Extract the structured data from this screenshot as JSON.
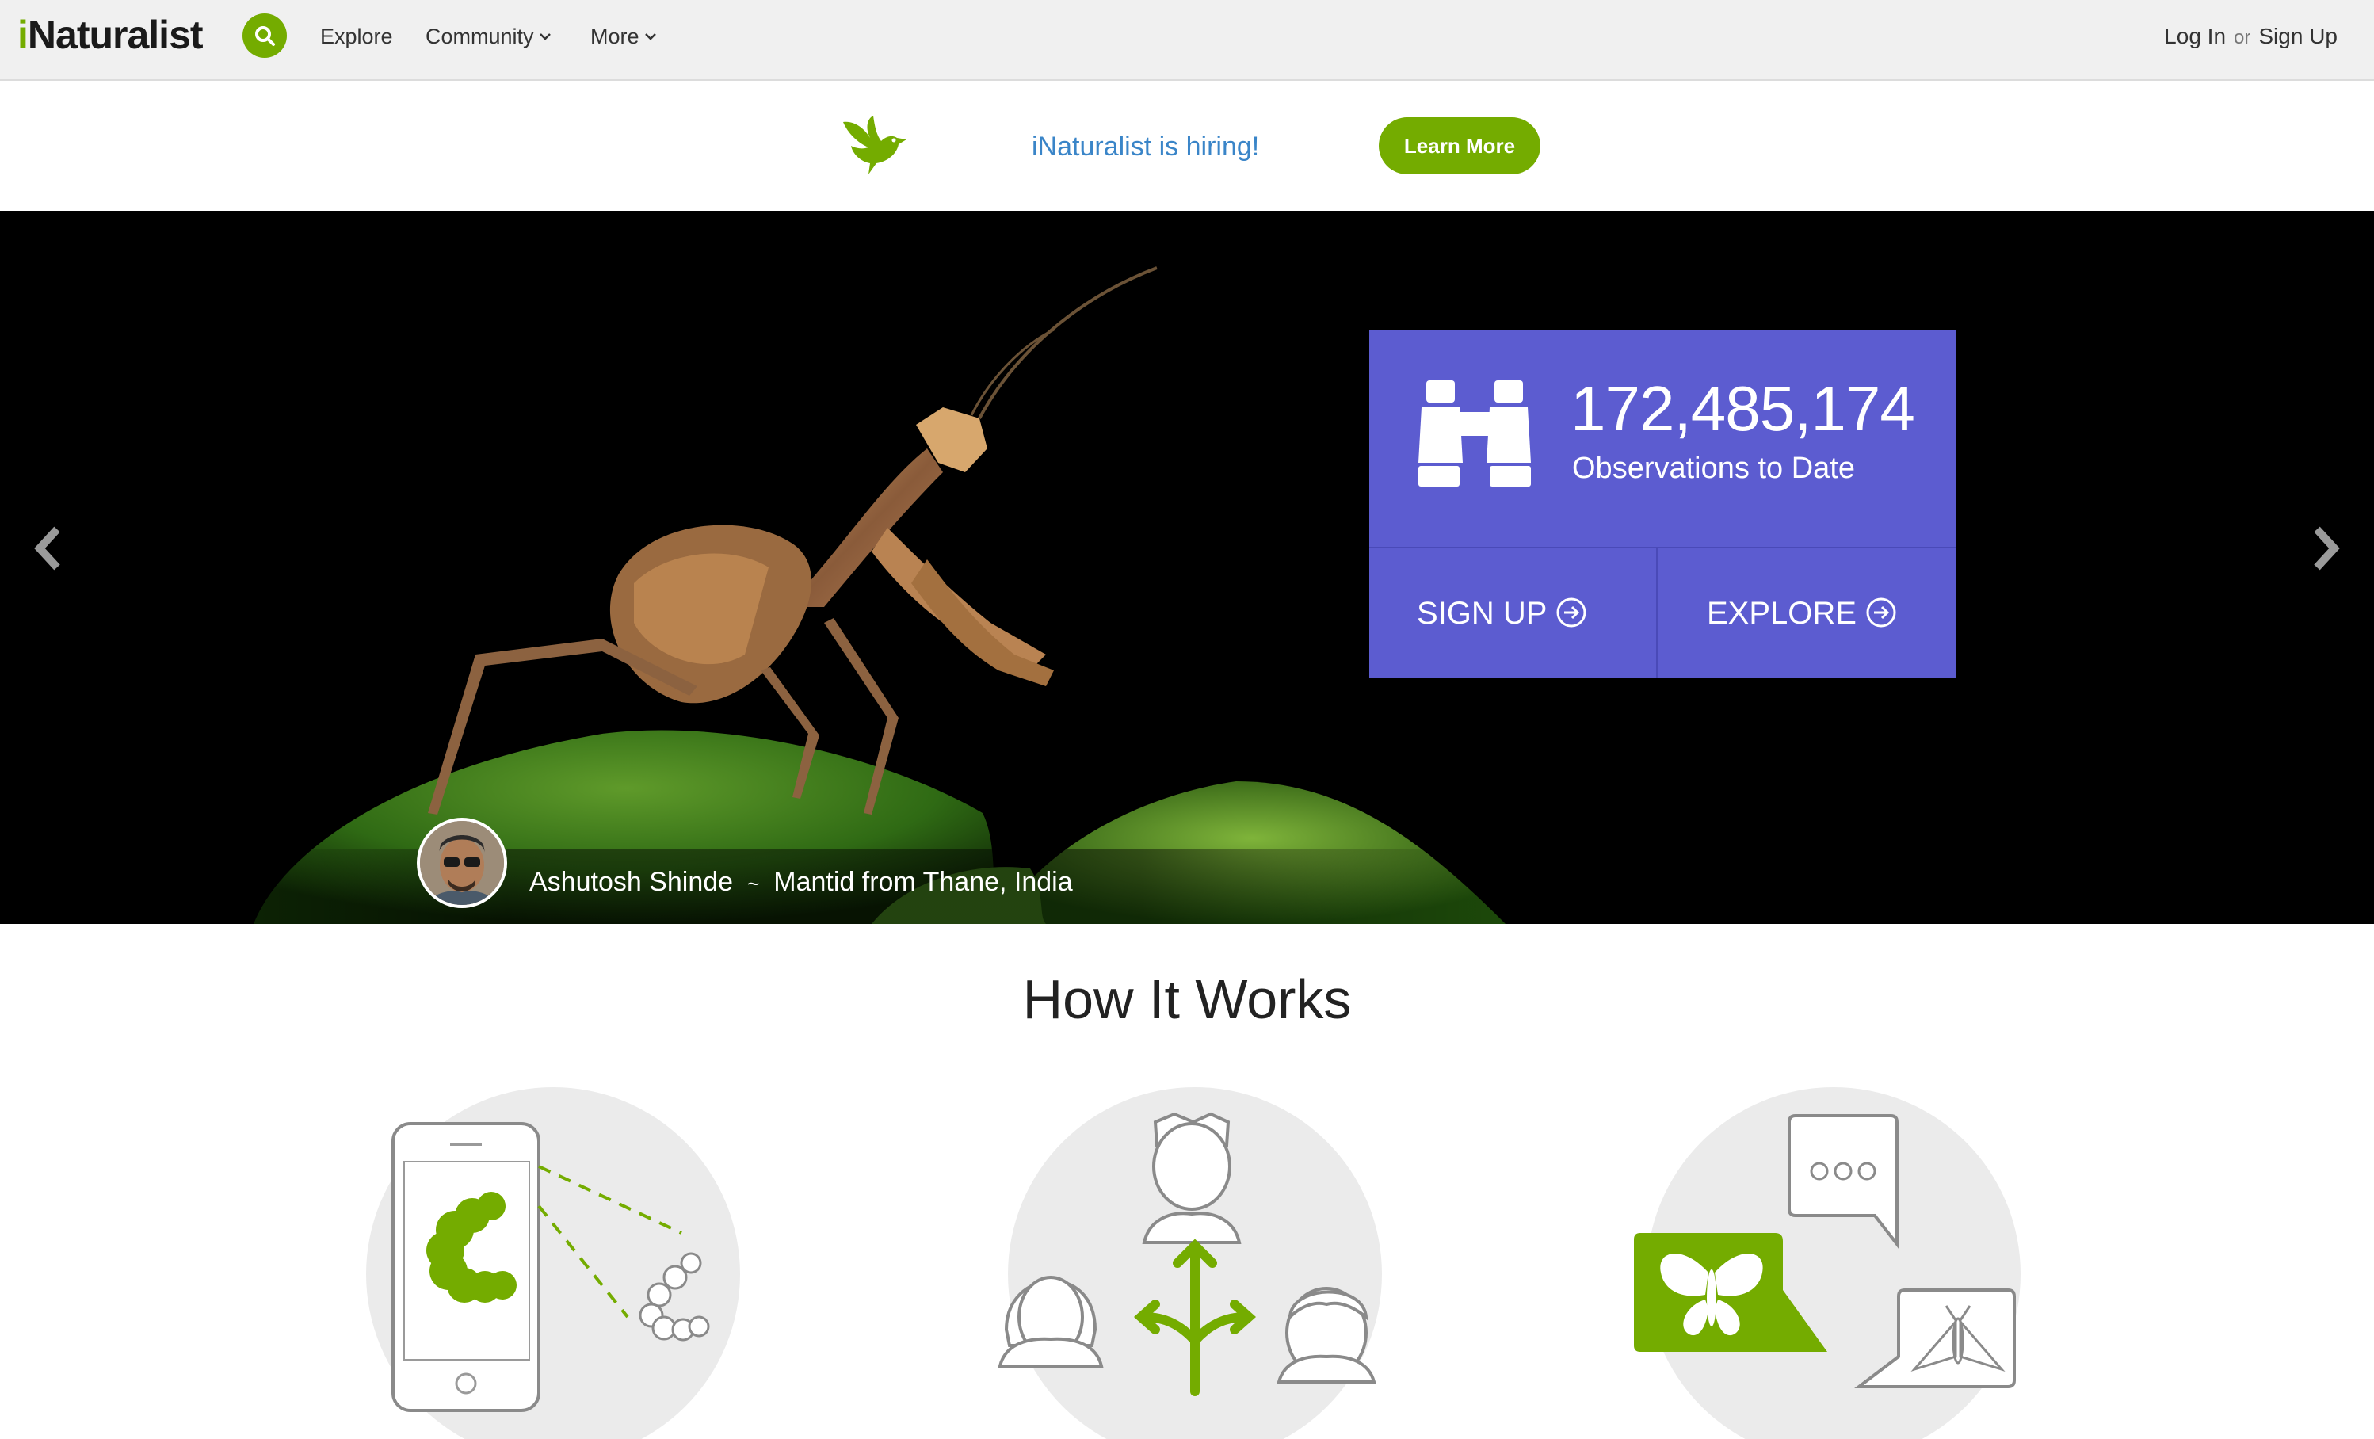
{
  "nav": {
    "logo_i": "i",
    "logo_rest": "Naturalist",
    "links": [
      "Explore",
      "Community",
      "More"
    ],
    "login": "Log In",
    "or": "or",
    "signup": "Sign Up"
  },
  "banner": {
    "message": "iNaturalist is hiring!",
    "button": "Learn More"
  },
  "hero": {
    "observation_count": "172,485,174",
    "observation_label": "Observations to Date",
    "signup_label": "SIGN UP",
    "explore_label": "EXPLORE",
    "photographer": "Ashutosh Shinde",
    "separator": "~",
    "species": "Mantid",
    "location": "from Thane, India"
  },
  "how_it_works": {
    "title": "How It Works"
  },
  "colors": {
    "brand_green": "#74ac00",
    "stats_purple": "#5c5cd0",
    "link_blue": "#3a85c8",
    "nav_bg": "#f0f0f0"
  }
}
